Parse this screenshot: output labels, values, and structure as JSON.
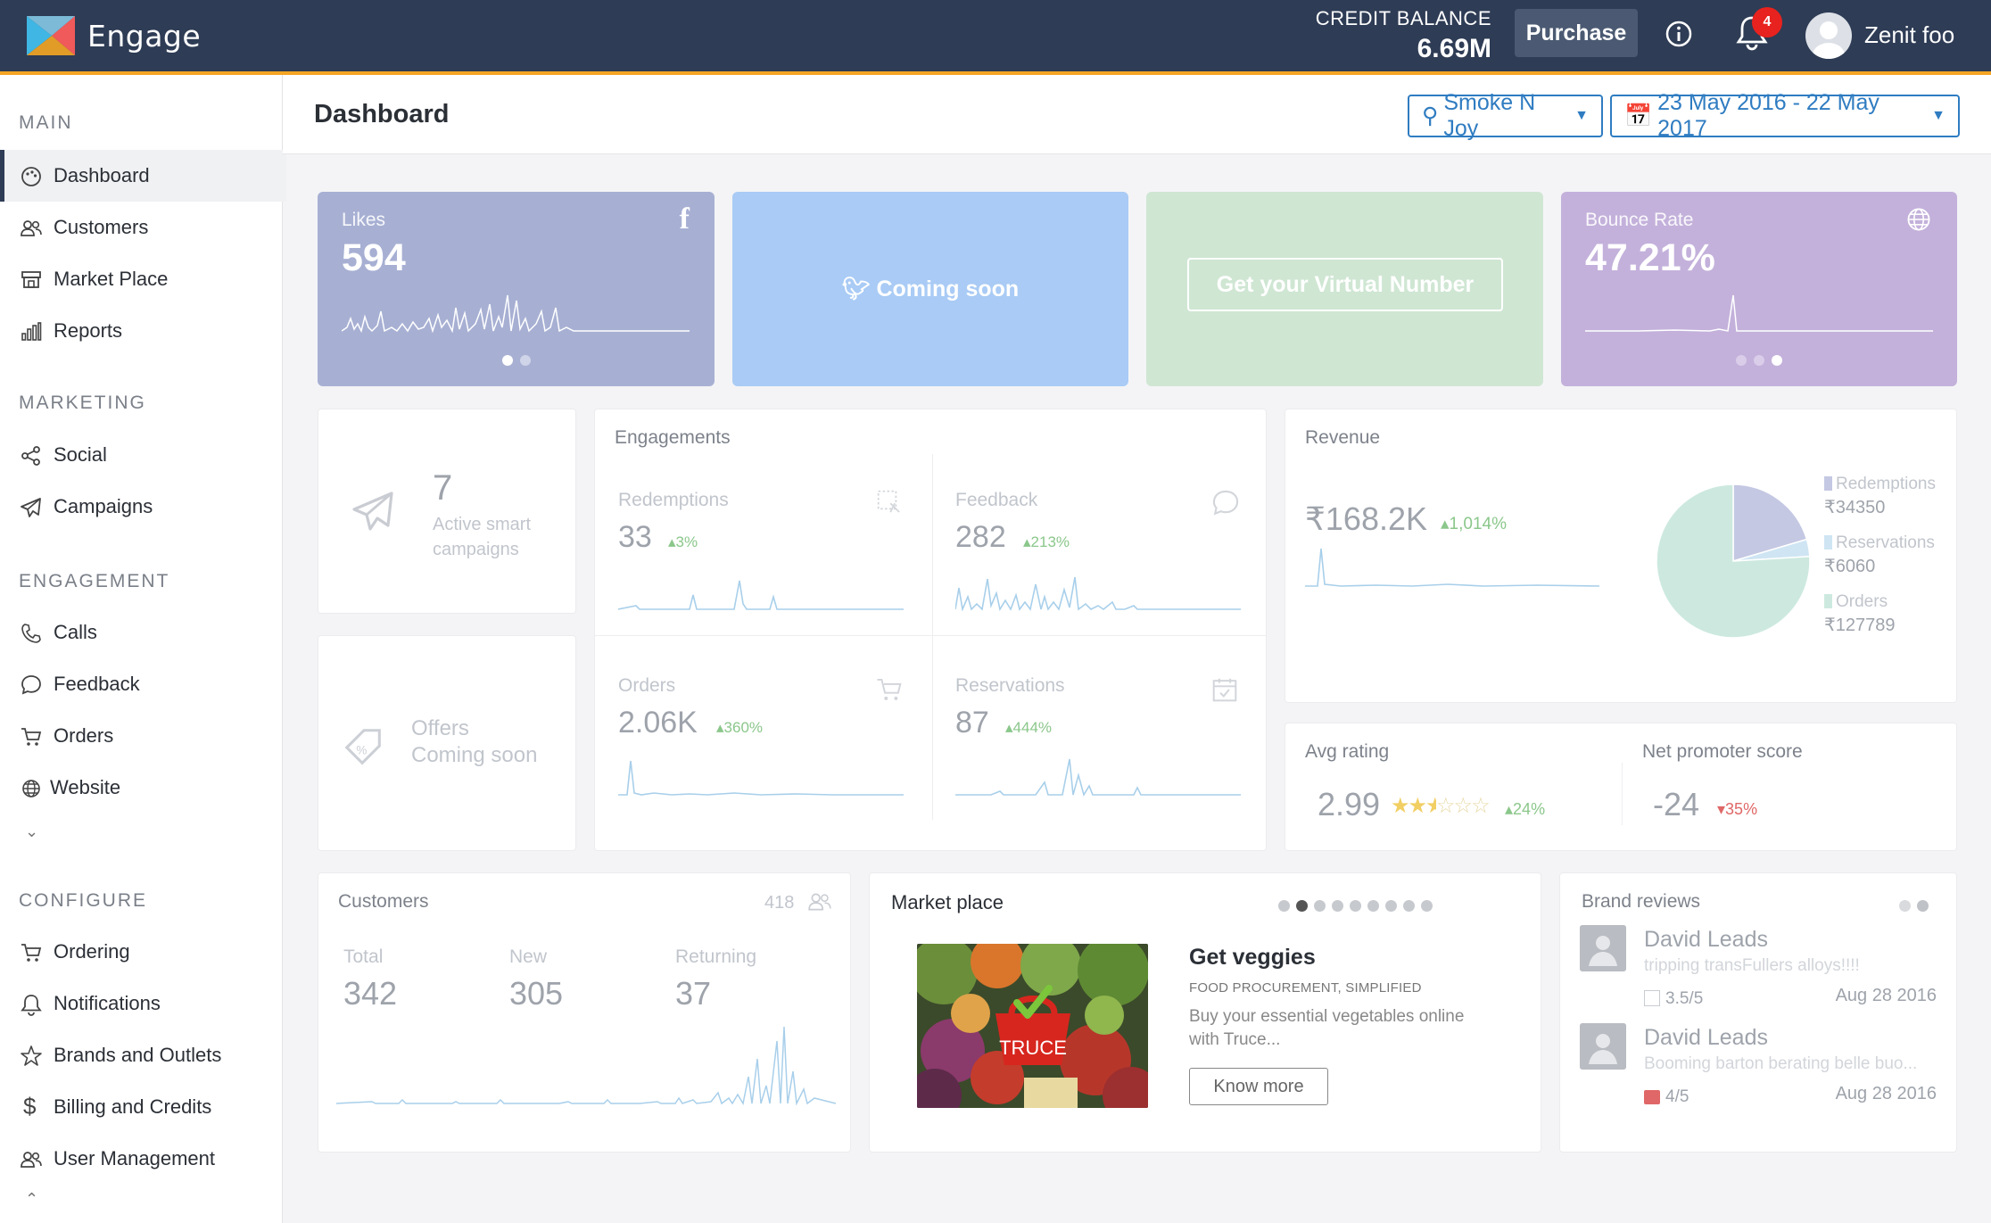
{
  "app": {
    "brand": "Engage",
    "credit_label": "CREDIT BALANCE",
    "credit_value": "6.69M",
    "purchase_label": "Purchase",
    "notification_count": "4",
    "user_name": "Zenit foo"
  },
  "sidebar": {
    "sections": [
      {
        "title": "MAIN",
        "items": [
          {
            "label": "Dashboard",
            "icon": "palette-icon",
            "active": true
          },
          {
            "label": "Customers",
            "icon": "users-icon"
          },
          {
            "label": "Market Place",
            "icon": "store-icon"
          },
          {
            "label": "Reports",
            "icon": "bar-chart-icon"
          }
        ]
      },
      {
        "title": "MARKETING",
        "items": [
          {
            "label": "Social",
            "icon": "share-icon"
          },
          {
            "label": "Campaigns",
            "icon": "paper-plane-icon"
          }
        ]
      },
      {
        "title": "ENGAGEMENT",
        "items": [
          {
            "label": "Calls",
            "icon": "phone-icon"
          },
          {
            "label": "Feedback",
            "icon": "chat-bubble-icon"
          },
          {
            "label": "Orders",
            "icon": "cart-icon"
          },
          {
            "label": "Website",
            "icon": "globe-icon"
          }
        ]
      },
      {
        "title": "CONFIGURE",
        "items": [
          {
            "label": "Ordering",
            "icon": "cart-icon"
          },
          {
            "label": "Notifications",
            "icon": "bell-icon"
          },
          {
            "label": "Brands and Outlets",
            "icon": "star-icon"
          },
          {
            "label": "Billing and Credits",
            "icon": "dollar-icon"
          },
          {
            "label": "User Management",
            "icon": "users-icon"
          }
        ]
      }
    ]
  },
  "header": {
    "title": "Dashboard",
    "outlet": "Smoke N Joy",
    "date_range": "23 May 2016 - 22 May 2017"
  },
  "tiles": {
    "likes": {
      "label": "Likes",
      "value": "594"
    },
    "twitter": {
      "text": "Coming soon"
    },
    "virtual_number": {
      "button": "Get your Virtual Number"
    },
    "bounce": {
      "label": "Bounce Rate",
      "value": "47.21%"
    }
  },
  "campaigns": {
    "count": "7",
    "label_line1": "Active smart",
    "label_line2": "campaigns"
  },
  "offers": {
    "line1": "Offers",
    "line2": "Coming soon"
  },
  "engagements": {
    "title": "Engagements",
    "redemptions": {
      "label": "Redemptions",
      "value": "33",
      "change": "3%"
    },
    "feedback": {
      "label": "Feedback",
      "value": "282",
      "change": "213%"
    },
    "orders": {
      "label": "Orders",
      "value": "2.06K",
      "change": "360%"
    },
    "reservations": {
      "label": "Reservations",
      "value": "87",
      "change": "444%"
    }
  },
  "revenue": {
    "title": "Revenue",
    "value": "₹168.2K",
    "change": "1,014%",
    "legend": [
      {
        "name": "Redemptions",
        "value": "₹34350",
        "color": "#c4c8e2"
      },
      {
        "name": "Reservations",
        "value": "₹6060",
        "color": "#cfe5f3"
      },
      {
        "name": "Orders",
        "value": "₹127789",
        "color": "#cde9df"
      }
    ],
    "pie": [
      34350,
      6060,
      127789
    ]
  },
  "ratings": {
    "avg_label": "Avg rating",
    "avg_value": "2.99",
    "avg_stars": 2.5,
    "avg_change": "24%",
    "nps_label": "Net promoter score",
    "nps_value": "-24",
    "nps_change": "35%"
  },
  "customers": {
    "title": "Customers",
    "count": "418",
    "total_label": "Total",
    "total": "342",
    "new_label": "New",
    "new": "305",
    "returning_label": "Returning",
    "returning": "37"
  },
  "marketplace": {
    "title": "Market place",
    "image_text": "TRUCE",
    "heading": "Get veggies",
    "subheading": "FOOD PROCUREMENT, SIMPLIFIED",
    "desc_line1": "Buy your essential vegetables online",
    "desc_line2": "with Truce...",
    "button": "Know more"
  },
  "reviews": {
    "title": "Brand reviews",
    "items": [
      {
        "name": "David Leads",
        "text": "tripping transFullers alloys!!!!",
        "rating": "3.5/5",
        "date": "Aug 28 2016"
      },
      {
        "name": "David Leads",
        "text": "Booming barton berating belle buo...",
        "rating": "4/5",
        "date": "Aug 28 2016"
      }
    ]
  }
}
